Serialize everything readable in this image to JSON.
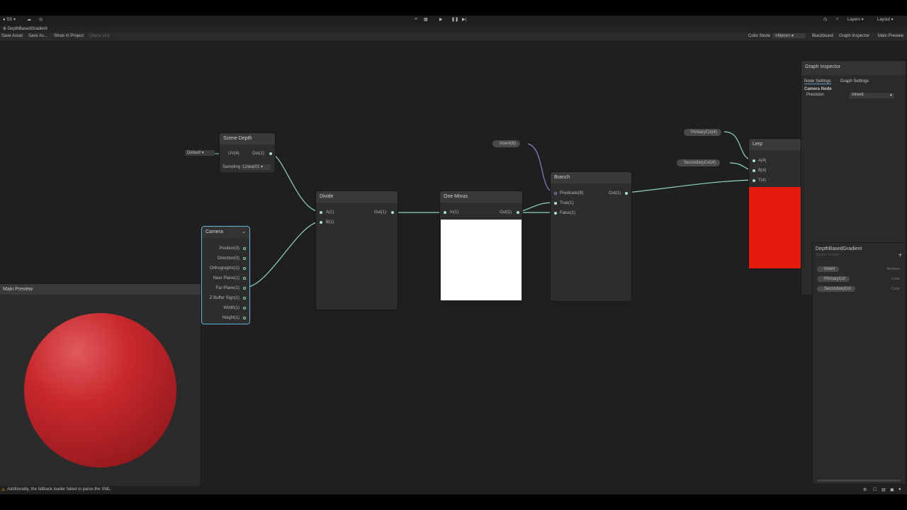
{
  "top_toolbar": {
    "account_label": "SS",
    "play_icons": [
      "play-icon",
      "pause-icon",
      "step-icon"
    ],
    "layers_label": "Layers",
    "layout_label": "Layout"
  },
  "window": {
    "tab_title": "DepthBasedGradient"
  },
  "graph_toolbar": {
    "save_asset": "Save Asset",
    "save_as": "Save As...",
    "show_in_project": "Show In Project",
    "check_out": "Check Out",
    "color_mode_label": "Color Mode",
    "color_mode_value": "<None>",
    "blackboard": "Blackboard",
    "graph_inspector": "Graph Inspector",
    "main_preview": "Main Preview"
  },
  "nodes": {
    "scene_depth": {
      "title": "Scene Depth",
      "uv_default": "Default",
      "input_uv": "UV(4)",
      "output": "Out(1)",
      "sampling_label": "Sampling",
      "sampling_value": "Linear01"
    },
    "camera": {
      "title": "Camera",
      "ports": [
        "Position(3)",
        "Direction(3)",
        "Orthographic(1)",
        "Near Plane(1)",
        "Far Plane(1)",
        "Z Buffer Sign(1)",
        "Width(1)",
        "Height(1)"
      ]
    },
    "divide": {
      "title": "Divide",
      "input_a": "A(1)",
      "input_b": "B(1)",
      "output": "Out(1)"
    },
    "one_minus": {
      "title": "One Minus",
      "input": "In(1)",
      "output": "Out(1)"
    },
    "branch": {
      "title": "Branch",
      "input_predicate": "Predicate(B)",
      "input_true": "True(1)",
      "input_false": "False(1)",
      "output": "Out(1)"
    },
    "lerp": {
      "title": "Lerp",
      "input_a": "A(4)",
      "input_b": "B(4)",
      "input_t": "T(4)",
      "preview_color": "#e41b0c"
    }
  },
  "property_nodes": {
    "invert": "Invert(B)",
    "primary_color": "PrimaryCol(4)",
    "secondary_color": "SecondaryCol(4)"
  },
  "graph_inspector": {
    "title": "Graph Inspector",
    "tab_node_settings": "Node Settings",
    "tab_graph_settings": "Graph Settings",
    "section": "Camera Node",
    "precision_label": "Precision",
    "precision_value": "Inherit"
  },
  "blackboard": {
    "title": "DepthBasedGradient",
    "subtitle": "Shader Graphs",
    "add_label": "+",
    "properties": [
      {
        "name": "Invert",
        "type": "Boolean"
      },
      {
        "name": "PrimaryCol",
        "type": "Color"
      },
      {
        "name": "SecondaryCol",
        "type": "Color"
      }
    ]
  },
  "main_preview": {
    "title": "Main Preview",
    "sphere_color": "#c8282c"
  },
  "status": {
    "message": "Additionally, the fallback loader failed to parse the XML."
  },
  "colors": {
    "wire": "#8fd3c7",
    "camera_outline": "#5fb3d3",
    "canvas": "#1f1f1f",
    "one_minus_preview": "#ffffff"
  }
}
